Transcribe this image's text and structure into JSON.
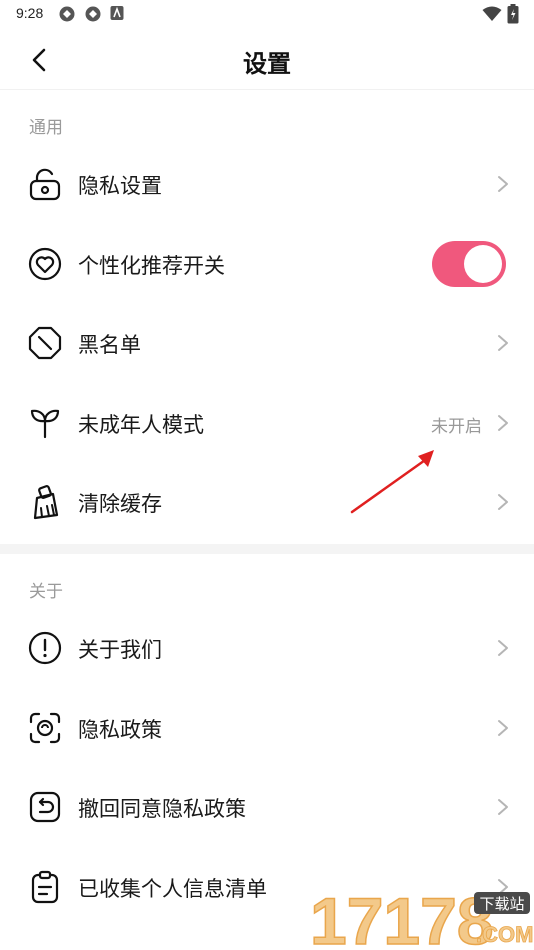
{
  "status_bar": {
    "time": "9:28"
  },
  "header": {
    "title": "设置"
  },
  "sections": [
    {
      "title": "通用",
      "items": [
        {
          "label": "隐私设置",
          "icon": "lock-icon"
        },
        {
          "label": "个性化推荐开关",
          "icon": "heart-icon",
          "toggle": true
        },
        {
          "label": "黑名单",
          "icon": "block-icon"
        },
        {
          "label": "未成年人模式",
          "icon": "sprout-icon",
          "value": "未开启"
        },
        {
          "label": "清除缓存",
          "icon": "broom-icon"
        }
      ]
    },
    {
      "title": "关于",
      "items": [
        {
          "label": "关于我们",
          "icon": "info-icon"
        },
        {
          "label": "隐私政策",
          "icon": "privacy-policy-icon"
        },
        {
          "label": "撤回同意隐私政策",
          "icon": "undo-icon"
        },
        {
          "label": "已收集个人信息清单",
          "icon": "clipboard-icon"
        }
      ]
    }
  ],
  "watermark": {
    "text": "17178",
    "badge": "下载站",
    "domain": ".COM"
  },
  "colors": {
    "accent": "#f0587d",
    "annotation": "#e02020"
  }
}
